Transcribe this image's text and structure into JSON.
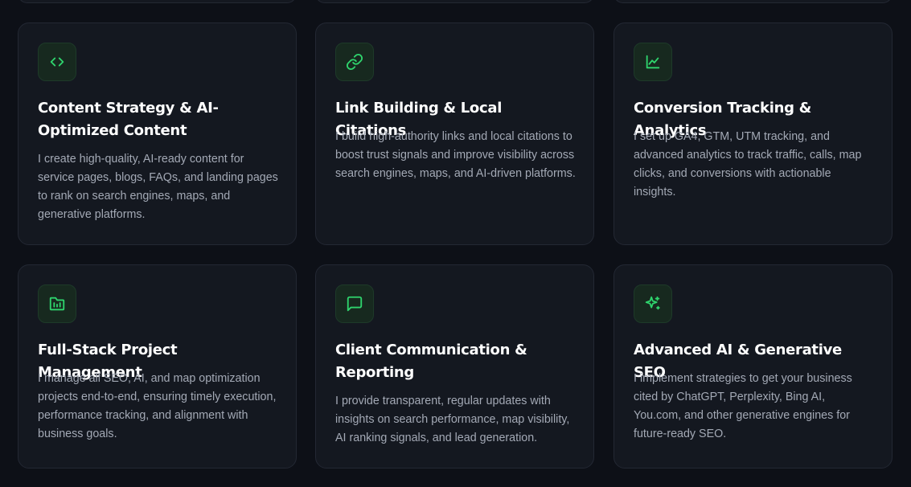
{
  "services": [
    {
      "icon": "code-icon",
      "title": "Content Strategy & AI-Optimized Content",
      "description": "I create high-quality, AI-ready content for service pages, blogs, FAQs, and landing pages to rank on search engines, maps, and generative platforms."
    },
    {
      "icon": "link-icon",
      "title": "Link Building & Local Citations",
      "description": "I build high-authority links and local citations to boost trust signals and improve visibility across search engines, maps, and AI-driven platforms."
    },
    {
      "icon": "line-chart-icon",
      "title": "Conversion Tracking & Analytics",
      "description": "I set up GA4, GTM, UTM tracking, and advanced analytics to track traffic, calls, map clicks, and conversions with actionable insights."
    },
    {
      "icon": "folder-chart-icon",
      "title": "Full-Stack Project Management",
      "description": "I manage all SEO, AI, and map optimization projects end-to-end, ensuring timely execution, performance tracking, and alignment with business goals."
    },
    {
      "icon": "message-square-icon",
      "title": "Client Communication & Reporting",
      "description": "I provide transparent, regular updates with insights on search performance, map visibility, AI ranking signals, and lead generation."
    },
    {
      "icon": "sparkles-icon",
      "title": "Advanced AI & Generative SEO",
      "description": "I implement strategies to get your business cited by ChatGPT, Perplexity, Bing AI, You.com, and other generative engines for future-ready SEO."
    }
  ],
  "colors": {
    "page_background": "#0d1017",
    "card_background": "#141820",
    "card_border": "#232833",
    "accent_green": "#2fd46d",
    "icon_tile": "#17291f",
    "title_text": "#ffffff",
    "body_text": "#a3a9b5"
  }
}
